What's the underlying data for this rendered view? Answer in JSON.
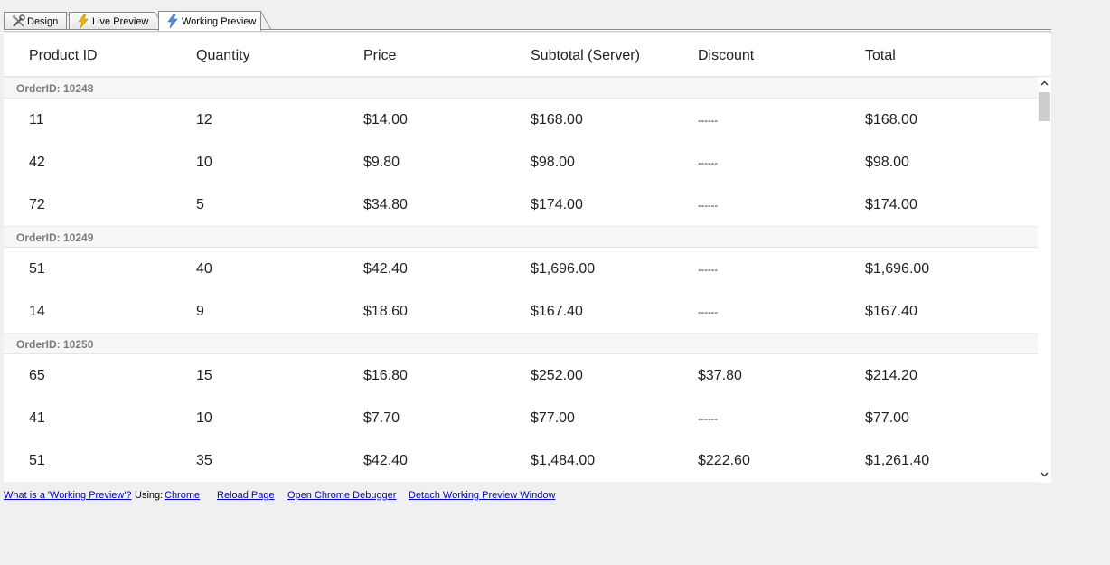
{
  "tabs": [
    {
      "label": "Design",
      "icon": "tools-icon"
    },
    {
      "label": "Live Preview",
      "icon": "lightning-icon"
    },
    {
      "label": "Working Preview",
      "icon": "lightning-blue-icon"
    }
  ],
  "grid": {
    "columns": [
      "Product ID",
      "Quantity",
      "Price",
      "Subtotal (Server)",
      "Discount",
      "Total"
    ],
    "groups": [
      {
        "label": "OrderID: 10248",
        "rows": [
          [
            "11",
            "12",
            "$14.00",
            "$168.00",
            "------",
            "$168.00"
          ],
          [
            "42",
            "10",
            "$9.80",
            "$98.00",
            "------",
            "$98.00"
          ],
          [
            "72",
            "5",
            "$34.80",
            "$174.00",
            "------",
            "$174.00"
          ]
        ]
      },
      {
        "label": "OrderID: 10249",
        "rows": [
          [
            "51",
            "40",
            "$42.40",
            "$1,696.00",
            "------",
            "$1,696.00"
          ],
          [
            "14",
            "9",
            "$18.60",
            "$167.40",
            "------",
            "$167.40"
          ]
        ]
      },
      {
        "label": "OrderID: 10250",
        "rows": [
          [
            "65",
            "15",
            "$16.80",
            "$252.00",
            "$37.80",
            "$214.20"
          ],
          [
            "41",
            "10",
            "$7.70",
            "$77.00",
            "------",
            "$77.00"
          ],
          [
            "51",
            "35",
            "$42.40",
            "$1,484.00",
            "$222.60",
            "$1,261.40"
          ]
        ]
      }
    ]
  },
  "footer": {
    "what_is_link": "What is a 'Working Preview'?",
    "using_label": "Using:",
    "browser_link": "Chrome",
    "reload_link": "Reload Page",
    "debugger_link": "Open Chrome Debugger",
    "detach_link": "Detach Working Preview Window"
  }
}
